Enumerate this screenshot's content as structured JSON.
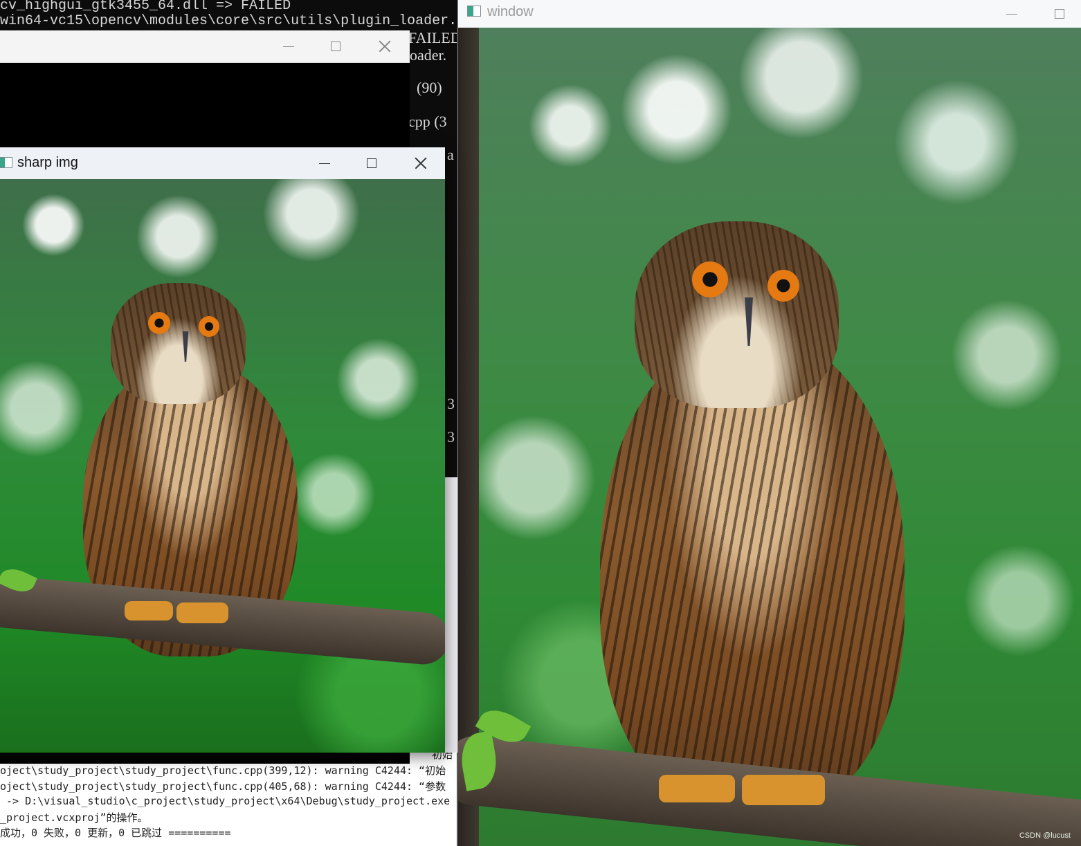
{
  "console": {
    "lines": [
      "cv_highgui_gtk3455_64.dll => FAILED",
      "win64-vc15\\opencv\\modules\\core\\src\\utils\\plugin_loader."
    ],
    "fragments": [
      "FAILED",
      "oader.",
      "(90)",
      "cpp (3",
      "a",
      "3",
      "3",
      ","
    ]
  },
  "windows": {
    "dark": {
      "title": ""
    },
    "sharp": {
      "title": "sharp img"
    },
    "right": {
      "title": "window"
    }
  },
  "output": {
    "lines": [
      "初始",
      "oject\\study_project\\study_project\\func.cpp(399,12): warning C4244: “初始",
      "oject\\study_project\\study_project\\func.cpp(405,68): warning C4244: “参数",
      " -> D:\\visual_studio\\c_project\\study_project\\x64\\Debug\\study_project.exe",
      "_project.vcxproj”的操作。",
      "成功，0 失败，0 更新，0 已跳过 =========="
    ]
  },
  "watermark": "CSDN @lucust",
  "colors": {
    "foliage": "#2f8a35",
    "owl_eye": "#e67a12"
  }
}
